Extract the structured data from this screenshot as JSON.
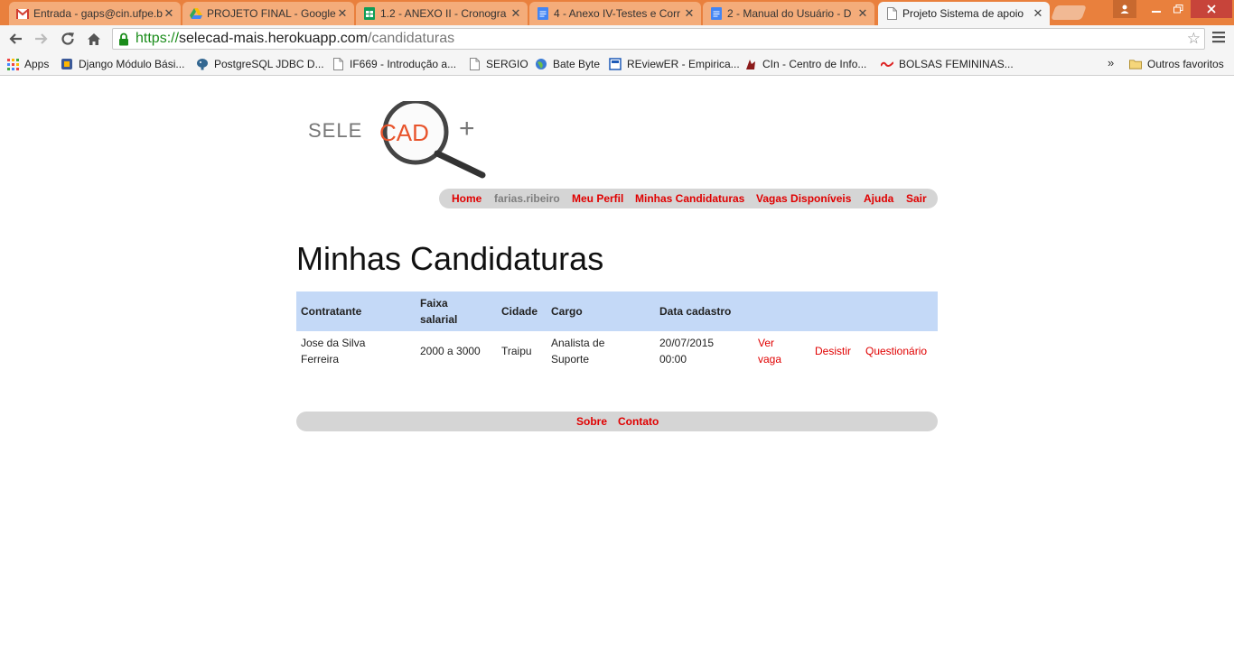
{
  "browser": {
    "tabs": [
      {
        "title": "Entrada - gaps@cin.ufpe.b",
        "icon": "gmail-icon"
      },
      {
        "title": "PROJETO FINAL - Google",
        "icon": "drive-icon"
      },
      {
        "title": "1.2 - ANEXO II - Cronogra",
        "icon": "sheets-icon"
      },
      {
        "title": "4 - Anexo IV-Testes e Corr",
        "icon": "docs-icon"
      },
      {
        "title": "2 - Manual do Usuário - D",
        "icon": "docs-icon"
      },
      {
        "title": "Projeto Sistema de apoio",
        "icon": "page-icon",
        "active": true
      }
    ],
    "url": {
      "scheme": "https://",
      "host": "selecad-mais.herokuapp.com",
      "path": "/candidaturas"
    },
    "bookmarks": [
      {
        "label": "Apps",
        "icon": "apps-grid-icon"
      },
      {
        "label": "Django Módulo Bási...",
        "icon": "bookmark-icon"
      },
      {
        "label": "PostgreSQL JDBC D...",
        "icon": "postgres-icon"
      },
      {
        "label": "IF669 - Introdução a...",
        "icon": "page-icon"
      },
      {
        "label": "SERGIO",
        "icon": "page-icon"
      },
      {
        "label": "Bate Byte",
        "icon": "globe-icon"
      },
      {
        "label": "REviewER - Empirica...",
        "icon": "bookmark-icon"
      },
      {
        "label": "CIn - Centro de Info...",
        "icon": "bookmark-icon"
      },
      {
        "label": "BOLSAS FEMININAS...",
        "icon": "bookmark-icon"
      }
    ],
    "bookmarks_more": "»",
    "other_bookmarks": "Outros favoritos"
  },
  "site": {
    "logo_text": {
      "part1": "SELE",
      "part2": "CAD",
      "part3": "+"
    },
    "nav": {
      "home": "Home",
      "username": "farias.ribeiro",
      "profile": "Meu Perfil",
      "applications": "Minhas Candidaturas",
      "jobs": "Vagas Disponíveis",
      "help": "Ajuda",
      "logout": "Sair"
    },
    "page_title": "Minhas Candidaturas",
    "table": {
      "headers": {
        "contratante": "Contratante",
        "faixa_line1": "Faixa",
        "faixa_line2": "salarial",
        "cidade": "Cidade",
        "cargo": "Cargo",
        "data": "Data cadastro"
      },
      "rows": [
        {
          "contratante_line1": "Jose da Silva",
          "contratante_line2": "Ferreira",
          "faixa": "2000 a 3000",
          "cidade": "Traipu",
          "cargo_line1": "Analista de",
          "cargo_line2": "Suporte",
          "data_line1": "20/07/2015",
          "data_line2": "00:00",
          "ver_line1": "Ver",
          "ver_line2": "vaga",
          "desistir": "Desistir",
          "questionario": "Questionário"
        }
      ]
    },
    "footer": {
      "about": "Sobre",
      "contact": "Contato"
    }
  },
  "colors": {
    "link": "#e00000",
    "table_header": "#c4d9f7",
    "nav_bg": "#d5d5d5",
    "titlebar": "#e9803d"
  }
}
